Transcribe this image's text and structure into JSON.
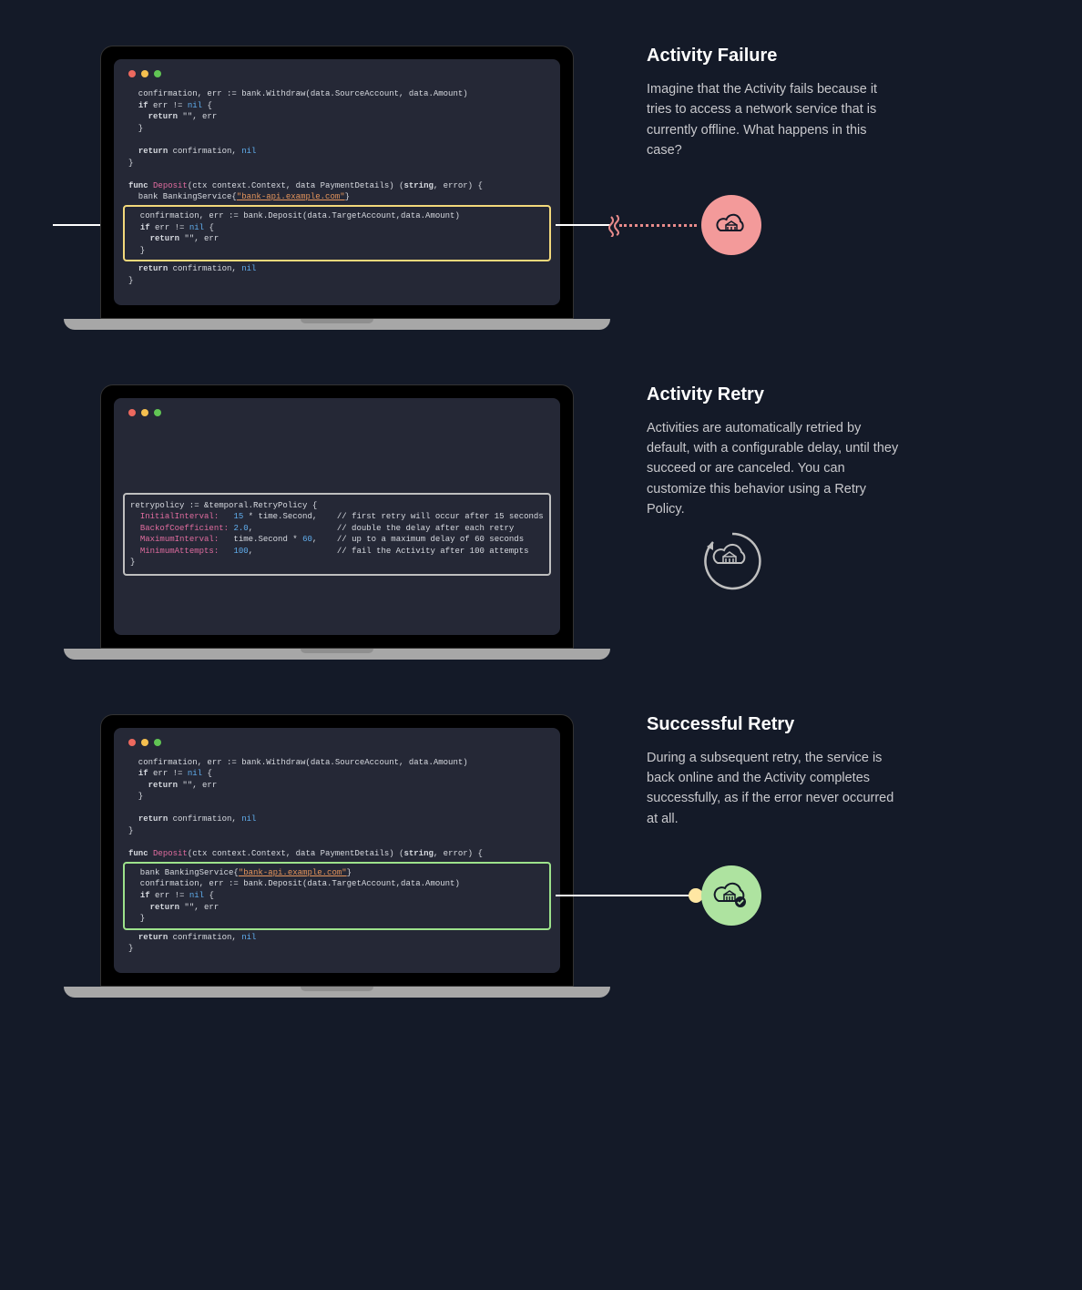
{
  "sections": [
    {
      "heading": "Activity Failure",
      "desc": "Imagine that the Activity fails because it tries to access a network service that is currently offline. What happens in this case?"
    },
    {
      "heading": "Activity Retry",
      "desc": "Activities are automatically retried by default, with a configurable delay, until they succeed or are canceled. You can customize this behavior using a Retry Policy."
    },
    {
      "heading": "Successful Retry",
      "desc": "During a subsequent retry, the service is back online and the Activity completes successfully, as if the error never occurred at all."
    }
  ],
  "code": {
    "withdraw": {
      "line1": "  confirmation, err := bank.Withdraw(data.SourceAccount, data.Amount)",
      "line2": "  if err != nil {",
      "line3": "    return \"\", err",
      "line4": "  }",
      "line5": "",
      "line6": "  return confirmation, nil",
      "line7": "}"
    },
    "deposit": {
      "sig": "func Deposit(ctx context.Context, data PaymentDetails) (string, error) {",
      "bank": "  bank BankingService{\"bank-api.example.com\"}",
      "conf": "  confirmation, err := bank.Deposit(data.TargetAccount,data.Amount)",
      "iferr": "  if err != nil {",
      "ret": "    return \"\", err",
      "close": "  }",
      "retconf": "  return confirmation, nil",
      "end": "}"
    },
    "retry": {
      "l1": "retrypolicy := &temporal.RetryPolicy {",
      "l2": "  InitialInterval:   15 * time.Second,    // first retry will occur after 15 seconds",
      "l3": "  BackofCoefficient: 2.0,                 // double the delay after each retry",
      "l4": "  MaximumInterval:   time.Second * 60,    // up to a maximum delay of 60 seconds",
      "l5": "  MinimumAttempts:   100,                 // fail the Activity after 100 attempts",
      "l6": "}"
    }
  }
}
